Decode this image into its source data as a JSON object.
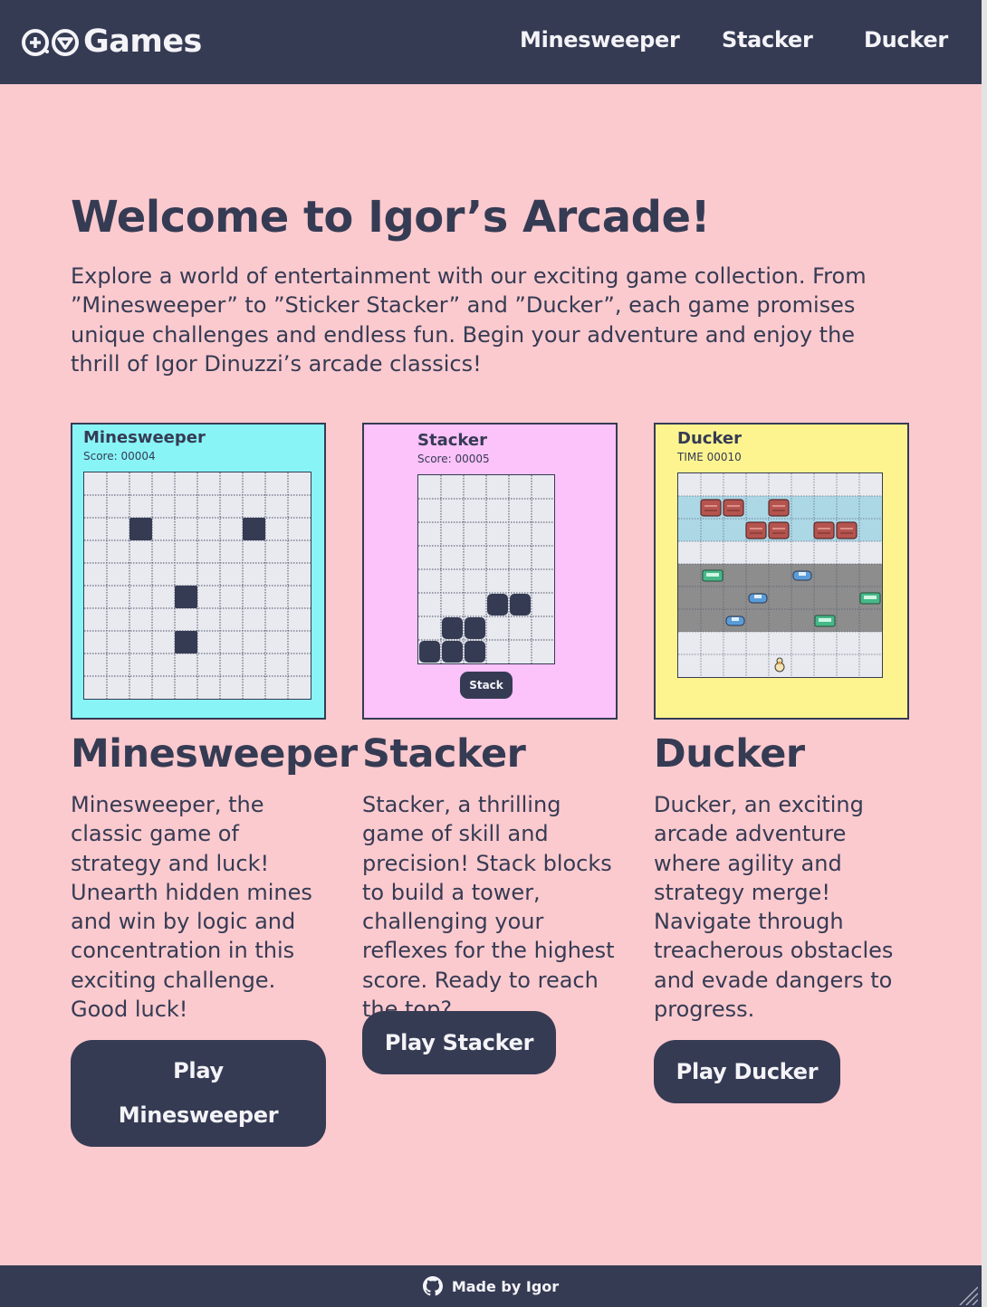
{
  "nav": {
    "logo_text": "Games",
    "links": [
      "Minesweeper",
      "Stacker",
      "Ducker"
    ]
  },
  "hero": {
    "title": "Welcome to Igor’s Arcade!",
    "text": "Explore a world of entertainment with our exciting game collection. From ”Minesweeper” to ”Sticker Stacker” and ”Ducker”, each game promises unique challenges and endless fun. Begin your adventure and enjoy the thrill of Igor Dinuzzi’s arcade classics!"
  },
  "cards": [
    {
      "preview_title": "Minesweeper",
      "preview_score": "Score: 00004",
      "bg_color": "#88f4f6",
      "title": "Minesweeper",
      "description": "Minesweeper, the classic game of strategy and luck! Unearth hidden mines and win by logic and concentration in this exciting challenge. Good luck!",
      "button_label": "Play Minesweeper"
    },
    {
      "preview_title": "Stacker",
      "preview_score": "Score: 00005",
      "preview_button": "Stack",
      "bg_color": "#fcc2fa",
      "title": "Stacker",
      "description": "Stacker, a thrilling game of skill and precision! Stack blocks to build a tower, challenging your reflexes for the highest score. Ready to reach the top?",
      "button_label": "Play Stacker"
    },
    {
      "preview_title": "Ducker",
      "preview_score": "TIME 00010",
      "bg_color": "#fef48f",
      "title": "Ducker",
      "description": "Ducker, an exciting arcade adventure where agility and strategy merge! Navigate through treacherous obstacles and evade dangers to progress.",
      "button_label": "Play Ducker"
    }
  ],
  "footer": {
    "text": "Made by Igor",
    "icon": "github-icon"
  },
  "colors": {
    "background": "#fbcace",
    "dark": "#363b54",
    "cell": "#e8eaef",
    "water": "#acd8e6",
    "road": "#8d8d8d"
  }
}
